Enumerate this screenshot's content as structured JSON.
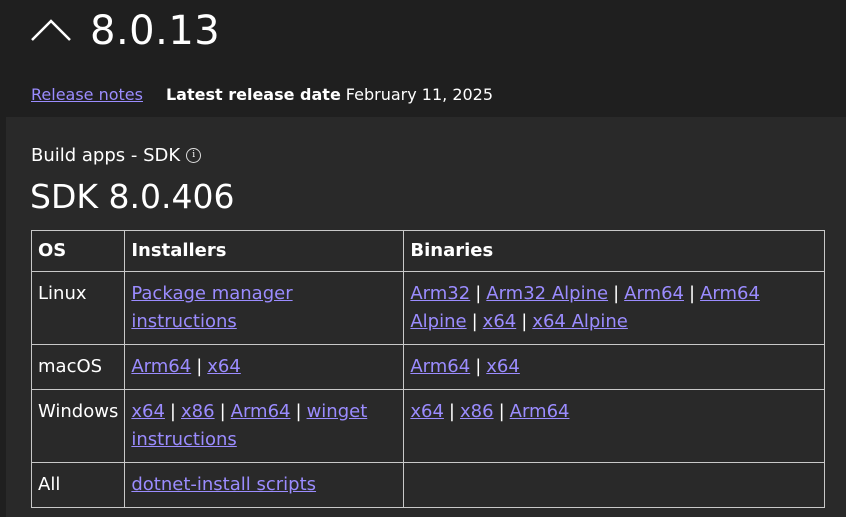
{
  "header": {
    "version": "8.0.13",
    "release_notes_label": "Release notes",
    "latest_release_label": "Latest release date",
    "latest_release_date": "February 11, 2025"
  },
  "section": {
    "label": "Build apps - SDK",
    "info_icon": "info-icon",
    "sdk_title": "SDK 8.0.406"
  },
  "table": {
    "headers": [
      "OS",
      "Installers",
      "Binaries"
    ],
    "rows": [
      {
        "os": "Linux",
        "installers": [
          "Package manager instructions"
        ],
        "binaries": [
          "Arm32",
          "Arm32 Alpine",
          "Arm64",
          "Arm64 Alpine",
          "x64",
          "x64 Alpine"
        ]
      },
      {
        "os": "macOS",
        "installers": [
          "Arm64",
          "x64"
        ],
        "binaries": [
          "Arm64",
          "x64"
        ]
      },
      {
        "os": "Windows",
        "installers": [
          "x64",
          "x86",
          "Arm64",
          "winget instructions"
        ],
        "binaries": [
          "x64",
          "x86",
          "Arm64"
        ]
      },
      {
        "os": "All",
        "installers": [
          "dotnet-install scripts"
        ],
        "binaries": []
      }
    ]
  },
  "colors": {
    "background": "#1f1f1f",
    "panel": "#292929",
    "link": "#9b8cff",
    "border": "#c8c8c8"
  }
}
